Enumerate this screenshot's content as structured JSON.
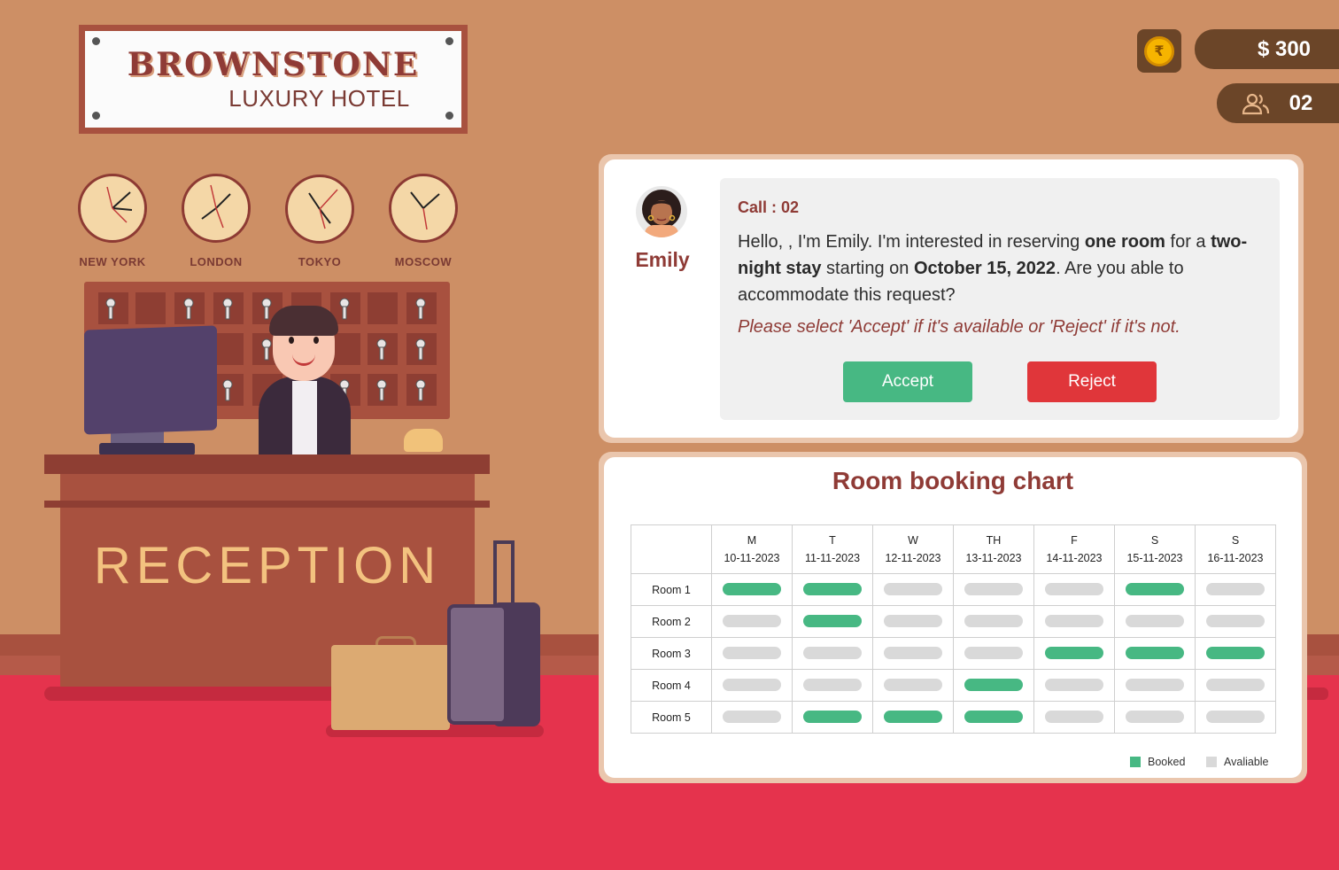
{
  "hotel": {
    "name": "BROWNSTONE",
    "subtitle": "LUXURY HOTEL",
    "desk_sign": "RECEPTION"
  },
  "clocks": [
    {
      "city": "NEW YORK"
    },
    {
      "city": "LONDON"
    },
    {
      "city": "TOKYO"
    },
    {
      "city": "MOSCOW"
    }
  ],
  "hud": {
    "money": "$ 300",
    "guests": "02",
    "coin_icon": "rupee-coin-icon",
    "guests_icon": "users-icon"
  },
  "call": {
    "label": "Call : 02",
    "caller_name": "Emily",
    "message_parts": [
      {
        "text": "Hello, , I'm Emily.  I'm interested in reserving ",
        "bold": false
      },
      {
        "text": "one room",
        "bold": true
      },
      {
        "text": " for a ",
        "bold": false
      },
      {
        "text": "two-night stay",
        "bold": true
      },
      {
        "text": " starting on ",
        "bold": false
      },
      {
        "text": "October 15, 2022",
        "bold": true
      },
      {
        "text": ". Are you able to accommodate this request?",
        "bold": false
      }
    ],
    "instruction": "Please select 'Accept' if it's available or 'Reject' if it's not.",
    "accept_label": "Accept",
    "reject_label": "Reject"
  },
  "colors": {
    "booked": "#47b883",
    "available": "#d9d9d9",
    "accent": "#8f3b36",
    "accept": "#47b883",
    "reject": "#e0363a"
  },
  "booking_chart": {
    "title": "Room booking chart",
    "days": [
      {
        "day": "M",
        "date": "10-11-2023"
      },
      {
        "day": "T",
        "date": "11-11-2023"
      },
      {
        "day": "W",
        "date": "12-11-2023"
      },
      {
        "day": "TH",
        "date": "13-11-2023"
      },
      {
        "day": "F",
        "date": "14-11-2023"
      },
      {
        "day": "S",
        "date": "15-11-2023"
      },
      {
        "day": "S",
        "date": "16-11-2023"
      }
    ],
    "rooms": [
      {
        "name": "Room 1",
        "booked": [
          true,
          true,
          false,
          false,
          false,
          true,
          false
        ]
      },
      {
        "name": "Room 2",
        "booked": [
          false,
          true,
          false,
          false,
          false,
          false,
          false
        ]
      },
      {
        "name": "Room 3",
        "booked": [
          false,
          false,
          false,
          false,
          true,
          true,
          true
        ]
      },
      {
        "name": "Room 4",
        "booked": [
          false,
          false,
          false,
          true,
          false,
          false,
          false
        ]
      },
      {
        "name": "Room 5",
        "booked": [
          false,
          true,
          true,
          true,
          false,
          false,
          false
        ]
      }
    ],
    "legend": {
      "booked": "Booked",
      "available": "Avaliable"
    }
  }
}
